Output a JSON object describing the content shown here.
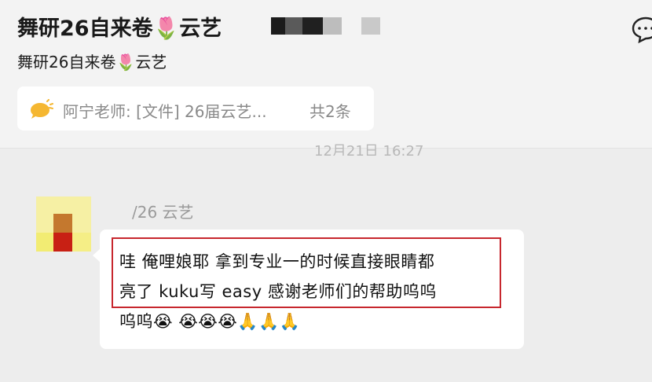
{
  "header": {
    "title": "舞研26自来卷🌷云艺",
    "subtitle": "舞研26自来卷🌷云艺"
  },
  "pinned": {
    "text": "阿宁老师: [文件] 26届云艺...",
    "count": "共2条"
  },
  "timestamp": "12月21日 16:27",
  "message": {
    "sender": "/26 云艺",
    "lines": [
      "哇 俺哩娘耶 拿到专业一的时候直接眼睛都",
      "亮了 kuku写 easy 感谢老师们的帮助呜呜",
      "呜呜😭 😭😭😭🙏🙏🙏"
    ]
  },
  "colors": {
    "highlight": "#c7272e",
    "icon": "#f5b731"
  },
  "icons": [
    "more-icon",
    "chat-bubble-icon"
  ]
}
